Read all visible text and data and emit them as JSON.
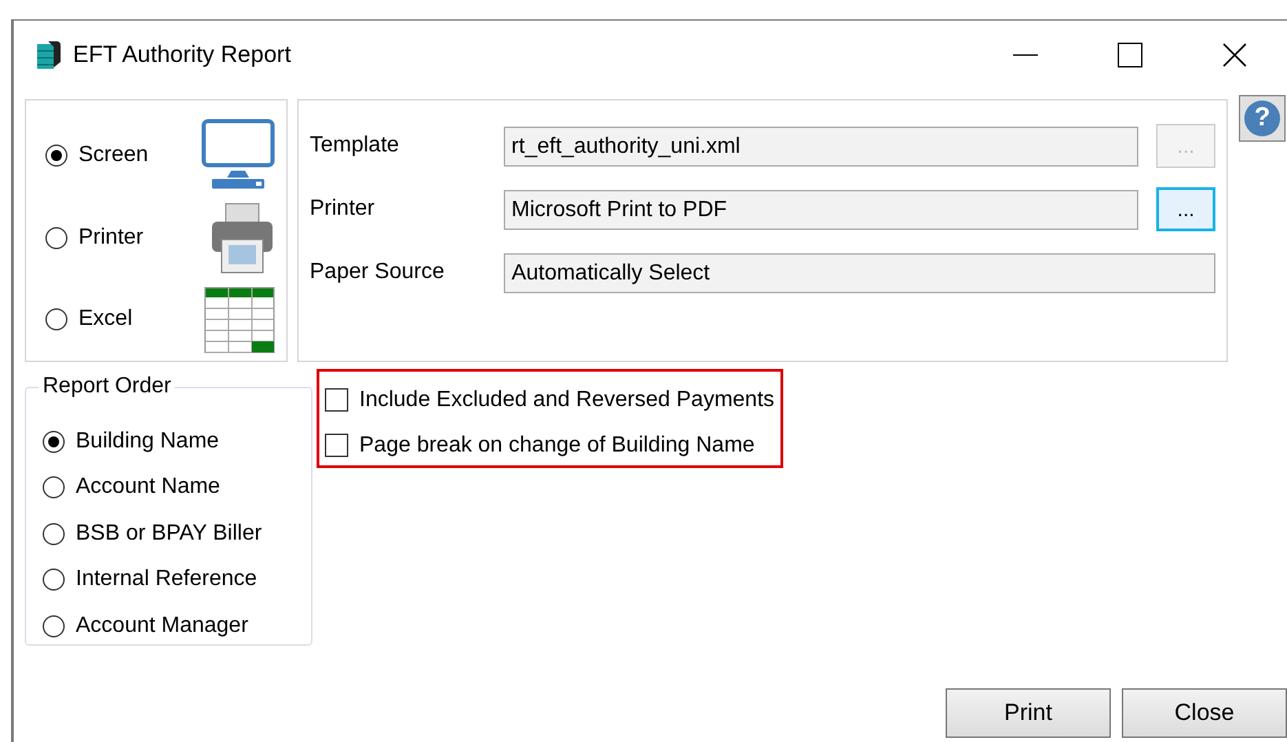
{
  "window": {
    "title": "EFT Authority Report"
  },
  "output": [
    {
      "label": "Screen",
      "selected": true,
      "kind": "monitor"
    },
    {
      "label": "Printer",
      "selected": false,
      "kind": "printer"
    },
    {
      "label": "Excel",
      "selected": false,
      "kind": "spreadsheet"
    }
  ],
  "settings": [
    {
      "label": "Template",
      "value": "rt_eft_authority_uni.xml",
      "browse": {
        "label": "...",
        "disabled": true,
        "focused": false
      }
    },
    {
      "label": "Printer",
      "value": "Microsoft Print to PDF",
      "browse": {
        "label": "...",
        "disabled": false,
        "focused": true
      }
    },
    {
      "label": "Paper Source",
      "value": "Automatically Select"
    }
  ],
  "help": {
    "label": "?"
  },
  "report_order": {
    "title": "Report Order",
    "items": [
      {
        "label": "Building Name",
        "selected": true
      },
      {
        "label": "Account Name",
        "selected": false
      },
      {
        "label": "BSB or BPAY Biller",
        "selected": false
      },
      {
        "label": "Internal Reference",
        "selected": false
      },
      {
        "label": "Account Manager",
        "selected": false
      }
    ]
  },
  "options": {
    "highlighted": true,
    "items": [
      {
        "label": "Include Excluded and Reversed Payments",
        "checked": false
      },
      {
        "label": "Page break on change of Building Name",
        "checked": false
      }
    ]
  },
  "buttons": [
    {
      "label": "Print"
    },
    {
      "label": "Close"
    }
  ]
}
